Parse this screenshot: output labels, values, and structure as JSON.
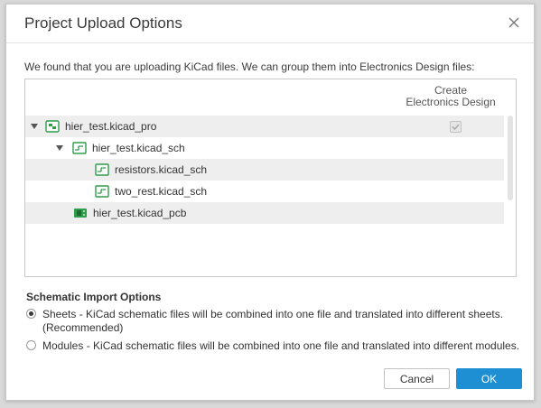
{
  "dialog": {
    "title": "Project Upload Options",
    "intro": "We found that you are uploading KiCad files. We can group them into Electronics Design files:",
    "column_header_line1": "Create",
    "column_header_line2": "Electronics Design",
    "tree": [
      {
        "label": "hier_test.kicad_pro",
        "icon": "project-icon",
        "expanded": true,
        "checkbox": true,
        "checked": true,
        "disabled": true
      },
      {
        "label": "hier_test.kicad_sch",
        "icon": "schematic-icon",
        "expanded": true
      },
      {
        "label": "resistors.kicad_sch",
        "icon": "schematic-icon"
      },
      {
        "label": "two_rest.kicad_sch",
        "icon": "schematic-icon"
      },
      {
        "label": "hier_test.kicad_pcb",
        "icon": "pcb-icon"
      }
    ],
    "section_label": "Schematic Import Options",
    "options": [
      {
        "line1": "Sheets - KiCad schematic files will be combined into one file and translated into different sheets.",
        "line2": "(Recommended)",
        "selected": true
      },
      {
        "line1": "Modules - KiCad schematic files will be combined into one file and translated into different modules.",
        "selected": false
      }
    ],
    "cancel_label": "Cancel",
    "ok_label": "OK",
    "colors": {
      "primary": "#1e8fd3",
      "icon_green": "#2e9c4a"
    }
  }
}
